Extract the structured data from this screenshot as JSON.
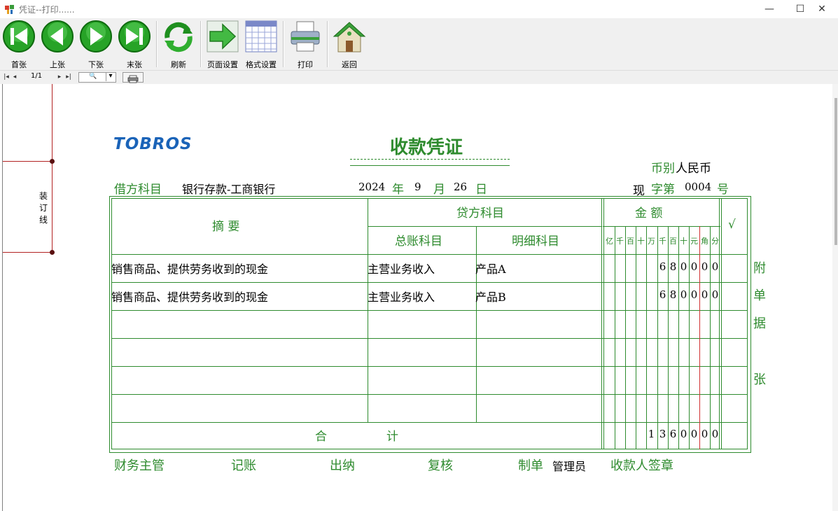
{
  "window": {
    "title": "凭证--打印......",
    "minimize": "—",
    "maximize": "☐",
    "close": "✕"
  },
  "toolbar": {
    "first": "首张",
    "prev": "上张",
    "next": "下张",
    "last": "末张",
    "refresh": "刷新",
    "page_setup": "页面设置",
    "format_setup": "格式设置",
    "print": "打印",
    "back": "返回"
  },
  "navbar": {
    "page": "1/1",
    "zoom_icon": "🔍",
    "dropdown": "▾"
  },
  "binding": {
    "label": "装订线"
  },
  "voucher": {
    "logo": "TOBROS",
    "title": "收款凭证",
    "currency_label": "币别",
    "currency_value": "人民币",
    "debit_label": "借方科目",
    "debit_value": "银行存款-工商银行",
    "year": "2024",
    "year_unit": "年",
    "month": "9",
    "month_unit": "月",
    "day": "26",
    "day_unit": "日",
    "no_prefix": "现",
    "no_mid": "字第",
    "no_value": "0004",
    "no_suffix": "号",
    "headers": {
      "summary": "摘    要",
      "credit": "贷方科目",
      "general": "总账科目",
      "detail": "明细科目",
      "amount": "金    额",
      "check": "√"
    },
    "units": [
      "亿",
      "千",
      "百",
      "十",
      "万",
      "千",
      "百",
      "十",
      "元",
      "角",
      "分"
    ],
    "rows": [
      {
        "summary": "销售商品、提供劳务收到的现金",
        "general": "主营业务收入",
        "detail": "产品A",
        "digits": [
          "",
          "",
          "",
          "",
          "",
          "6",
          "8",
          "0",
          "0",
          "0",
          "0"
        ]
      },
      {
        "summary": "销售商品、提供劳务收到的现金",
        "general": "主营业务收入",
        "detail": "产品B",
        "digits": [
          "",
          "",
          "",
          "",
          "",
          "6",
          "8",
          "0",
          "0",
          "0",
          "0"
        ]
      }
    ],
    "total_label_1": "合",
    "total_label_2": "计",
    "total_digits": [
      "",
      "",
      "",
      "",
      "1",
      "3",
      "6",
      "0",
      "0",
      "0",
      "0"
    ],
    "attachment": [
      "附",
      "单",
      "据",
      "张"
    ],
    "footer": {
      "supervisor": "财务主管",
      "bookkeeper": "记账",
      "cashier": "出纳",
      "reviewer": "复核",
      "maker_label": "制单",
      "maker_value": "管理员",
      "receiver": "收款人签章"
    }
  }
}
